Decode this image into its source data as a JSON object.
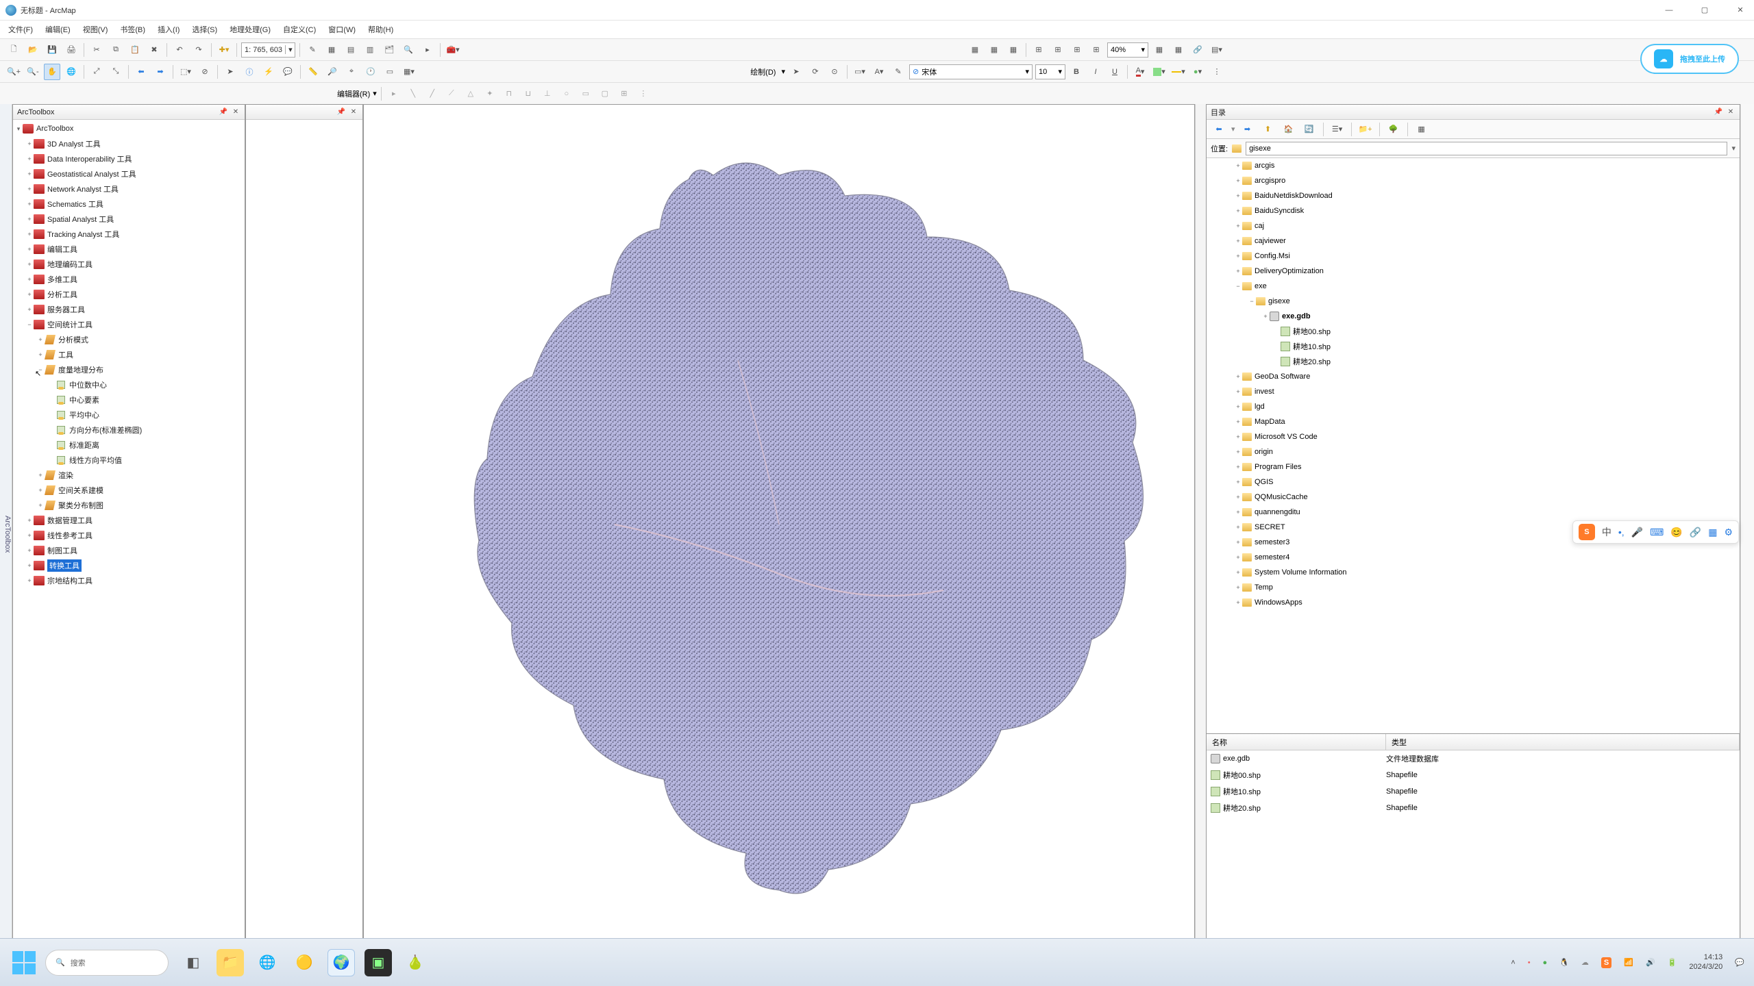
{
  "title": "无标题 - ArcMap",
  "menus": [
    "文件(F)",
    "编辑(E)",
    "视图(V)",
    "书签(B)",
    "插入(I)",
    "选择(S)",
    "地理处理(G)",
    "自定义(C)",
    "窗口(W)",
    "帮助(H)"
  ],
  "scale": "1: 765, 603",
  "zoom_pct": "40%",
  "editor_label": "编辑器(R)",
  "draw_label": "绘制(D)",
  "font_name": "宋体",
  "font_size": "10",
  "upload_label": "拖拽至此上传",
  "sidebar_tab": "ArcToolbox",
  "toolbox": {
    "title": "ArcToolbox",
    "root": "ArcToolbox",
    "items": [
      {
        "label": "3D Analyst 工具",
        "type": "toolbox"
      },
      {
        "label": "Data Interoperability 工具",
        "type": "toolbox"
      },
      {
        "label": "Geostatistical Analyst 工具",
        "type": "toolbox"
      },
      {
        "label": "Network Analyst 工具",
        "type": "toolbox"
      },
      {
        "label": "Schematics 工具",
        "type": "toolbox"
      },
      {
        "label": "Spatial Analyst 工具",
        "type": "toolbox"
      },
      {
        "label": "Tracking Analyst 工具",
        "type": "toolbox"
      },
      {
        "label": "编辑工具",
        "type": "toolbox"
      },
      {
        "label": "地理编码工具",
        "type": "toolbox"
      },
      {
        "label": "多维工具",
        "type": "toolbox"
      },
      {
        "label": "分析工具",
        "type": "toolbox"
      },
      {
        "label": "服务器工具",
        "type": "toolbox"
      }
    ],
    "spatial_stats": {
      "label": "空间统计工具",
      "expanded": true
    },
    "spatial_children": [
      {
        "label": "分析模式",
        "type": "cat"
      },
      {
        "label": "工具",
        "type": "cat"
      }
    ],
    "measure_dist": {
      "label": "度量地理分布",
      "expanded": true
    },
    "measure_tools": [
      "中位数中心",
      "中心要素",
      "平均中心",
      "方向分布(标准差椭圆)",
      "标准距离",
      "线性方向平均值"
    ],
    "measure_after": [
      {
        "label": "渲染",
        "type": "cat"
      },
      {
        "label": "空间关系建模",
        "type": "cat"
      },
      {
        "label": "聚类分布制图",
        "type": "cat"
      }
    ],
    "tail": [
      {
        "label": "数据管理工具",
        "type": "toolbox"
      },
      {
        "label": "线性参考工具",
        "type": "toolbox"
      },
      {
        "label": "制图工具",
        "type": "toolbox"
      }
    ],
    "selected": "转换工具",
    "last": "宗地结构工具"
  },
  "catalog": {
    "title": "目录",
    "location_label": "位置:",
    "location_value": "gisexe",
    "folders": [
      "arcgis",
      "arcgispro",
      "BaiduNetdiskDownload",
      "BaiduSyncdisk",
      "caj",
      "cajviewer",
      "Config.Msi",
      "DeliveryOptimization"
    ],
    "exe_folder": "exe",
    "gisexe_folder": "gisexe",
    "gdb_name": "exe.gdb",
    "shapefiles": [
      "耕地00.shp",
      "耕地10.shp",
      "耕地20.shp"
    ],
    "folders2": [
      "GeoDa Software",
      "invest",
      "lgd",
      "MapData",
      "Microsoft VS Code",
      "origin",
      "Program Files",
      "QGIS",
      "QQMusicCache",
      "quannengditu",
      "SECRET",
      "semester3",
      "semester4",
      "System Volume Information",
      "Temp",
      "WindowsApps"
    ],
    "cols": [
      "名称",
      "类型"
    ],
    "files": [
      {
        "name": "exe.gdb",
        "type": "文件地理数据库",
        "icon": "gdb"
      },
      {
        "name": "耕地00.shp",
        "type": "Shapefile",
        "icon": "shp"
      },
      {
        "name": "耕地10.shp",
        "type": "Shapefile",
        "icon": "shp"
      },
      {
        "name": "耕地20.shp",
        "type": "Shapefile",
        "icon": "shp"
      }
    ]
  },
  "taskbar": {
    "search_placeholder": "搜索",
    "time": "14:13",
    "date": "2024/3/20"
  },
  "ime": {
    "lang": "中"
  }
}
